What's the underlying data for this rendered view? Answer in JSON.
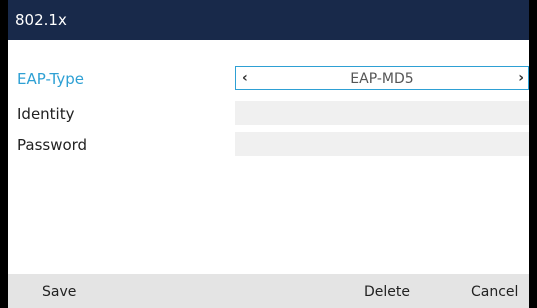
{
  "window": {
    "title": "802.1x"
  },
  "form": {
    "eap_type_label": "EAP-Type",
    "eap_type_value": "EAP-MD5",
    "identity_label": "Identity",
    "identity_value": "",
    "password_label": "Password",
    "password_value": ""
  },
  "softkeys": {
    "save": "Save",
    "delete": "Delete",
    "cancel": "Cancel"
  },
  "icons": {
    "prev": "chevron-left-icon",
    "next": "chevron-right-icon"
  },
  "colors": {
    "title_bar": "#18294a",
    "accent": "#2ea0d4",
    "softkey_bar": "#e4e4e4",
    "field_bg": "#f0f0f0"
  }
}
